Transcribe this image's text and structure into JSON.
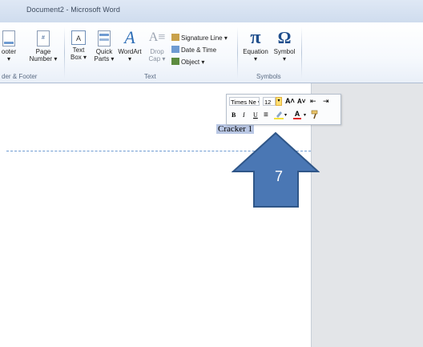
{
  "window": {
    "title": "Document2 - Microsoft Word"
  },
  "ribbon": {
    "groups": [
      {
        "name": "header_footer",
        "label": "der & Footer"
      },
      {
        "name": "text",
        "label": "Text"
      },
      {
        "name": "symbols",
        "label": "Symbols"
      }
    ],
    "footer_button": {
      "label1": "ooter",
      "label2": "▾"
    },
    "page_number_button": {
      "label1": "Page",
      "label2": "Number ▾"
    },
    "text_box_button": {
      "label1": "Text",
      "label2": "Box ▾"
    },
    "quick_parts_button": {
      "label1": "Quick",
      "label2": "Parts ▾"
    },
    "wordart_button": {
      "label1": "WordArt",
      "label2": "▾"
    },
    "drop_cap_button": {
      "label1": "Drop",
      "label2": "Cap ▾"
    },
    "signature_line": "Signature Line ▾",
    "date_time": "Date & Time",
    "object": "Object ▾",
    "equation_button": {
      "label1": "Equation",
      "label2": "▾",
      "glyph": "π"
    },
    "symbol_button": {
      "label1": "Symbol",
      "label2": "▾",
      "glyph": "Ω"
    }
  },
  "mini_toolbar": {
    "font": "Times Ne ▾",
    "size": "12",
    "size_drop": "▾",
    "grow": "A˄",
    "shrink": "A˅",
    "bold": "B",
    "italic": "I",
    "underline": "U",
    "center": "≡",
    "highlight_color": "#f5e23a",
    "font_color": "#e02020"
  },
  "document": {
    "selected_text": "Cracker 1"
  },
  "annotation": {
    "number": "7",
    "color": "#4a77b4",
    "border": "#2f5688"
  }
}
